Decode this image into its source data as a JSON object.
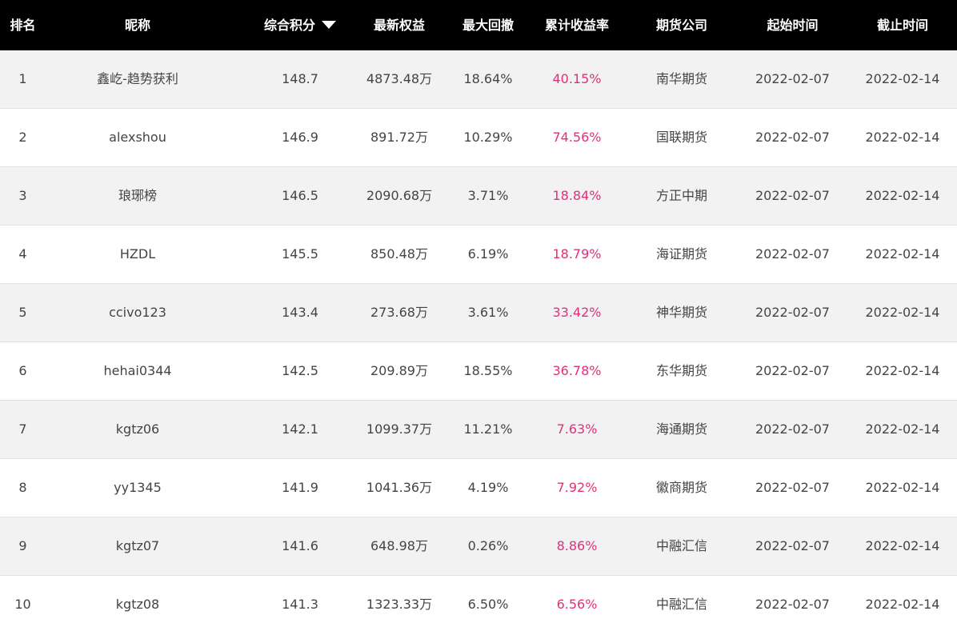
{
  "header": {
    "rank": "排名",
    "name": "昵称",
    "score": "综合积分",
    "equity": "最新权益",
    "drawdown": "最大回撤",
    "return": "累计收益率",
    "broker": "期货公司",
    "start": "起始时间",
    "end": "截止时间"
  },
  "colors": {
    "header_bg": "#000000",
    "row_alt": "#f2f2f2",
    "return_text": "#e0307a"
  },
  "rows": [
    {
      "rank": "1",
      "name": "鑫屹-趋势获利",
      "score": "148.7",
      "equity": "4873.48万",
      "drawdown": "18.64%",
      "return": "40.15%",
      "broker": "南华期货",
      "start": "2022-02-07",
      "end": "2022-02-14"
    },
    {
      "rank": "2",
      "name": "alexshou",
      "score": "146.9",
      "equity": "891.72万",
      "drawdown": "10.29%",
      "return": "74.56%",
      "broker": "国联期货",
      "start": "2022-02-07",
      "end": "2022-02-14"
    },
    {
      "rank": "3",
      "name": "琅琊榜",
      "score": "146.5",
      "equity": "2090.68万",
      "drawdown": "3.71%",
      "return": "18.84%",
      "broker": "方正中期",
      "start": "2022-02-07",
      "end": "2022-02-14"
    },
    {
      "rank": "4",
      "name": "HZDL",
      "score": "145.5",
      "equity": "850.48万",
      "drawdown": "6.19%",
      "return": "18.79%",
      "broker": "海证期货",
      "start": "2022-02-07",
      "end": "2022-02-14"
    },
    {
      "rank": "5",
      "name": "ccivo123",
      "score": "143.4",
      "equity": "273.68万",
      "drawdown": "3.61%",
      "return": "33.42%",
      "broker": "神华期货",
      "start": "2022-02-07",
      "end": "2022-02-14"
    },
    {
      "rank": "6",
      "name": "hehai0344",
      "score": "142.5",
      "equity": "209.89万",
      "drawdown": "18.55%",
      "return": "36.78%",
      "broker": "东华期货",
      "start": "2022-02-07",
      "end": "2022-02-14"
    },
    {
      "rank": "7",
      "name": "kgtz06",
      "score": "142.1",
      "equity": "1099.37万",
      "drawdown": "11.21%",
      "return": "7.63%",
      "broker": "海通期货",
      "start": "2022-02-07",
      "end": "2022-02-14"
    },
    {
      "rank": "8",
      "name": "yy1345",
      "score": "141.9",
      "equity": "1041.36万",
      "drawdown": "4.19%",
      "return": "7.92%",
      "broker": "徽商期货",
      "start": "2022-02-07",
      "end": "2022-02-14"
    },
    {
      "rank": "9",
      "name": "kgtz07",
      "score": "141.6",
      "equity": "648.98万",
      "drawdown": "0.26%",
      "return": "8.86%",
      "broker": "中融汇信",
      "start": "2022-02-07",
      "end": "2022-02-14"
    },
    {
      "rank": "10",
      "name": "kgtz08",
      "score": "141.3",
      "equity": "1323.33万",
      "drawdown": "6.50%",
      "return": "6.56%",
      "broker": "中融汇信",
      "start": "2022-02-07",
      "end": "2022-02-14"
    }
  ]
}
